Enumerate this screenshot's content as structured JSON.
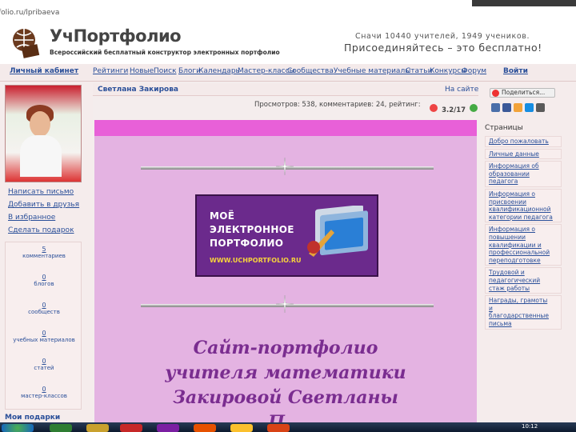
{
  "browser": {
    "address": "folio.ru/lpribaeva"
  },
  "header": {
    "logo_title": "УчПортфолио",
    "logo_subtitle": "Всероссийский бесплатный конструктор электронных портфолио",
    "stats": "Сначи 10440 учителей, 1949 учеников.",
    "join_text": "Присоединяйтесь – это бесплатно!"
  },
  "topnav": [
    {
      "label": "Личный кабинет",
      "bold": true
    },
    {
      "label": "Рейтинги",
      "bold": false
    },
    {
      "label": "Новые",
      "bold": false
    },
    {
      "label": "Поиск",
      "bold": false
    },
    {
      "label": "Блоги",
      "bold": false
    },
    {
      "label": "Календарь",
      "bold": false
    },
    {
      "label": "Мастер-классы",
      "bold": false
    },
    {
      "label": "Сообщества",
      "bold": false
    },
    {
      "label": "Учебные материалы",
      "bold": false
    },
    {
      "label": "Статьи",
      "bold": false
    },
    {
      "label": "Конкурсы",
      "bold": false
    },
    {
      "label": "Форум",
      "bold": false
    },
    {
      "label": "Войти",
      "bold": true
    }
  ],
  "left_menu": [
    "Написать письмо",
    "Добавить в друзья",
    "В избранное",
    "Сделать подарок"
  ],
  "counters": [
    {
      "value": "5",
      "label": "комментариев"
    },
    {
      "value": "0",
      "label": "блогов"
    },
    {
      "value": "0",
      "label": "сообществ"
    },
    {
      "value": "0",
      "label": "учебных материалов"
    },
    {
      "value": "0",
      "label": "статей"
    },
    {
      "value": "0",
      "label": "мастер-классов"
    }
  ],
  "gifts_label": "Мои подарки",
  "profile": {
    "name": "Светлана Закирова",
    "on_site": "На сайте",
    "views_text": "Просмотров: 538, комментариев: 24, рейтинг:",
    "rating": "3.2/17"
  },
  "banner": {
    "line1": "МОЁ",
    "line2": "ЭЛЕКТРОННОЕ",
    "line3": "ПОРТФОЛИО",
    "url": "WWW.UCHPORTFOLIO.RU"
  },
  "main_title": [
    "Сайт-портфолио",
    "учителя математики",
    "Закировой Светланы",
    "П..."
  ],
  "right_panel": {
    "share_label": "Поделиться...",
    "pages_heading": "Страницы",
    "pages": [
      [
        "Добро пожаловать"
      ],
      [
        "Личные данные"
      ],
      [
        "Информация об",
        "образовании",
        "педагога"
      ],
      [
        "Информация о",
        "присвоении",
        "квалификационной",
        "категории педагога"
      ],
      [
        "Информация о",
        "повышении",
        "квалификации и",
        "профессиональной",
        "переподготовке"
      ],
      [
        "Трудовой и",
        "педагогический",
        "стаж работы"
      ],
      [
        "Награды, грамоты",
        "и",
        "благодарственные",
        "письма"
      ]
    ]
  },
  "taskbar": {
    "clock": "10:12"
  },
  "colors": {
    "link": "#2a4f99",
    "content_bg": "#e4b3e2",
    "accent_bar": "#e860d8",
    "title": "#7a2d90",
    "banner_bg": "#6b2a8c"
  }
}
